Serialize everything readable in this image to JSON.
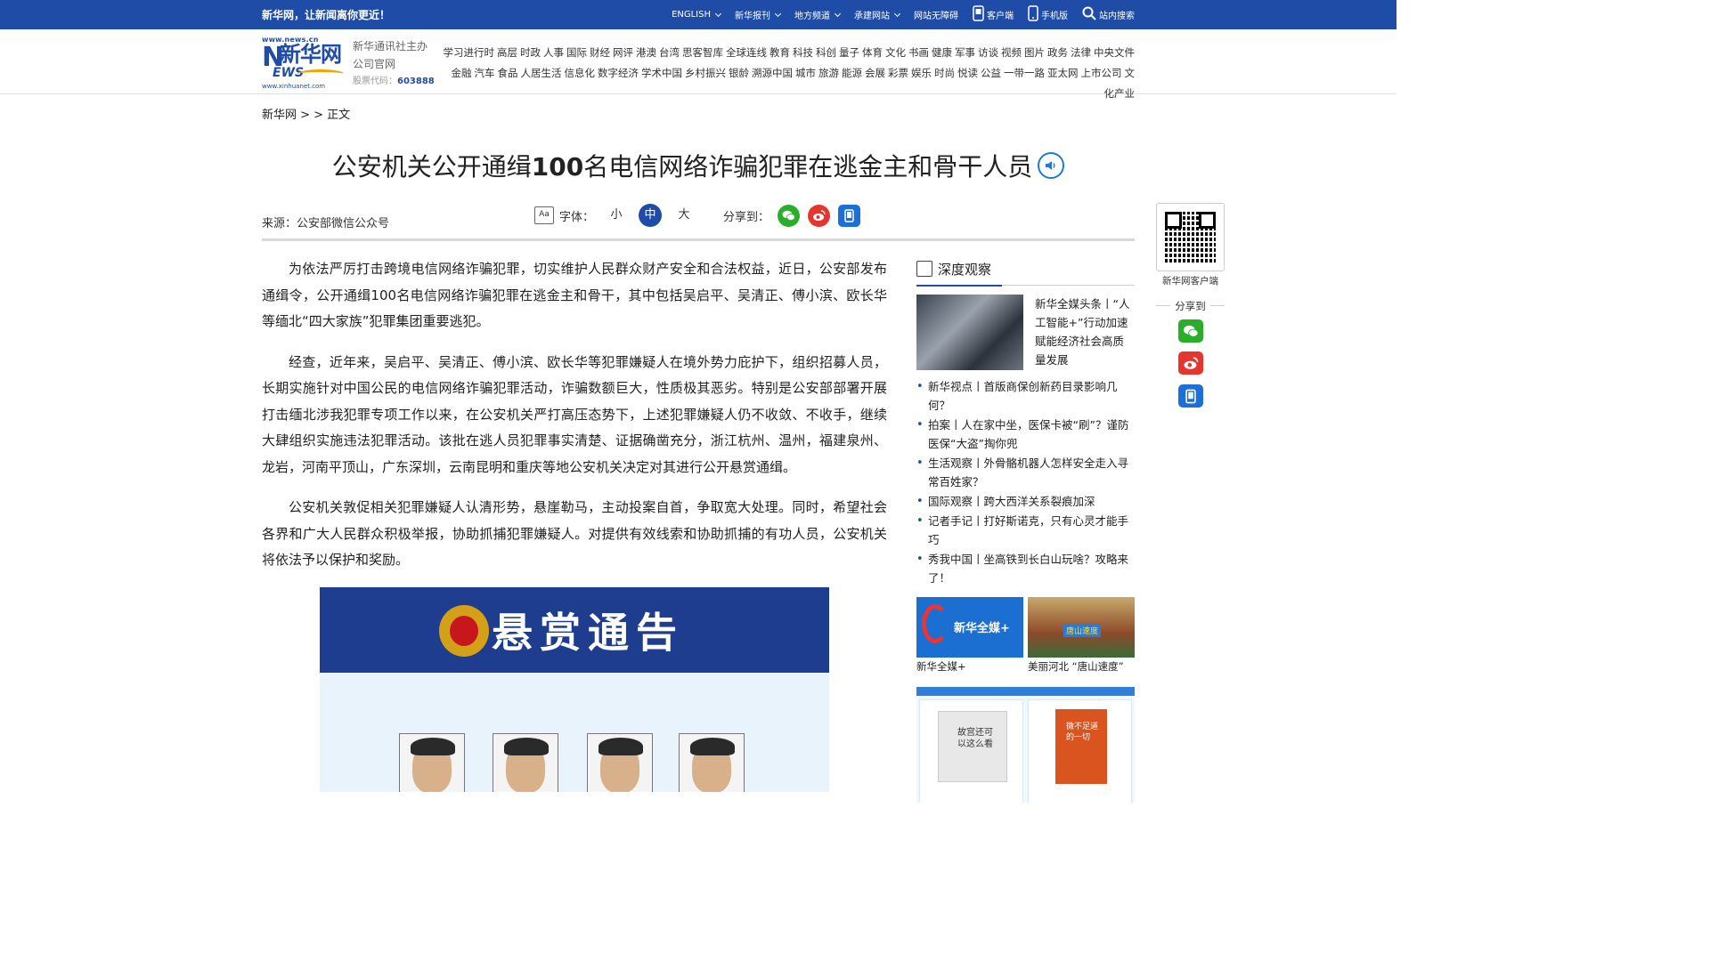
{
  "topbar": {
    "slogan": "新华网，让新闻离你更近！",
    "nav": [
      {
        "label": "ENGLISH",
        "dropdown": true
      },
      {
        "label": "新华报刊",
        "dropdown": true
      },
      {
        "label": "地方频道",
        "dropdown": true
      },
      {
        "label": "承建网站",
        "dropdown": true
      },
      {
        "label": "网站无障碍",
        "dropdown": false
      },
      {
        "label": "客户端",
        "icon": "client-icon"
      },
      {
        "label": "手机版",
        "icon": "phone-icon"
      },
      {
        "label": "站内搜索",
        "icon": "search-icon"
      }
    ],
    "bg_color": "#1e4ca6"
  },
  "header": {
    "logo": {
      "url_top": "www.news.cn",
      "cn": "新华网",
      "n_letter": "N",
      "ews": "EWS",
      "url_bottom": "www.xinhuanet.com"
    },
    "corp_line1": "新华通讯社主办",
    "corp_line2": "公司官网",
    "stock_label": "股票代码：",
    "stock_code": "603888",
    "channels_row1": [
      "学习进行时",
      "高层",
      "时政",
      "人事",
      "国际",
      "财经",
      "网评",
      "港澳",
      "台湾",
      "思客智库",
      "全球连线",
      "教育",
      "科技",
      "科创",
      "量子",
      "体育",
      "文化",
      "书画",
      "健康",
      "军事",
      "访谈",
      "视频",
      "图片",
      "政务",
      "法律",
      "中央文件"
    ],
    "channels_row2": [
      "金融",
      "汽车",
      "食品",
      "人居生活",
      "信息化",
      "数字经济",
      "学术中国",
      "乡村振兴",
      "银龄",
      "溯源中国",
      "城市",
      "旅游",
      "能源",
      "会展",
      "彩票",
      "娱乐",
      "时尚",
      "悦读",
      "公益",
      "一带一路",
      "亚太网",
      "上市公司",
      "文化产业"
    ]
  },
  "breadcrumb": {
    "text": "新华网 > > 正文"
  },
  "article": {
    "title_part1": "公安机关公开通缉",
    "title_bold": "100",
    "title_part2": "名电信网络诈骗犯罪在逃金主和骨干人员",
    "source": "来源：公安部微信公众号",
    "font_label": "字体：",
    "font_small": "小",
    "font_medium": "中",
    "font_large": "大",
    "share_label": "分享到：",
    "paragraphs": [
      "为依法严厉打击跨境电信网络诈骗犯罪，切实维护人民群众财产安全和合法权益，近日，公安部发布通缉令，公开通缉100名电信网络诈骗犯罪在逃金主和骨干，其中包括吴启平、吴清正、傅小滨、欧长华等缅北“四大家族”犯罪集团重要逃犯。",
      "经查，近年来，吴启平、吴清正、傅小滨、欧长华等犯罪嫌疑人在境外势力庇护下，组织招募人员，长期实施针对中国公民的电信网络诈骗犯罪活动，诈骗数额巨大，性质极其恶劣。特别是公安部部署开展打击缅北涉我犯罪专项工作以来，在公安机关严打高压态势下，上述犯罪嫌疑人仍不收敛、不收手，继续大肆组织实施违法犯罪活动。该批在逃人员犯罪事实清楚、证据确凿充分，浙江杭州、温州，福建泉州、龙岩，河南平顶山，广东深圳，云南昆明和重庆等地公安机关决定对其进行公开悬赏通缉。",
      "公安机关敦促相关犯罪嫌疑人认清形势，悬崖勒马，主动投案自首，争取宽大处理。同时，希望社会各界和广大人民群众积极举报，协助抓捕犯罪嫌疑人。对提供有效线索和协助抓捕的有功人员，公安机关将依法予以保护和奖励。"
    ],
    "poster_title": "悬赏通告"
  },
  "sidebar": {
    "title": "深度观察",
    "featured": "新华全媒头条丨“人工智能+”行动加速赋能经济社会高质量发展",
    "news": [
      "新华视点丨首版商保创新药目录影响几何？",
      "拍案丨人在家中坐，医保卡被“刷”？谨防医保“大盗”掏你兜",
      "生活观察丨外骨骼机器人怎样安全走入寻常百姓家？",
      "国际观察丨跨大西洋关系裂痕加深",
      "记者手记丨打好斯诺克，只有心灵才能手巧",
      "秀我中国丨坐高铁到长白山玩啥？攻略来了！"
    ],
    "thumbs": [
      {
        "caption": "新华全媒+",
        "img_text": "新华全媒+"
      },
      {
        "caption": "美丽河北 “唐山速度”",
        "img_text": "唐山速度"
      }
    ],
    "books": [
      {
        "title": "故宫还可以这么看"
      },
      {
        "title": "微不足道的一切"
      }
    ]
  },
  "float_panel": {
    "qr_caption": "新华网客户端",
    "share_label": "分享到"
  },
  "colors": {
    "brand": "#1e4ca6",
    "wechat": "#2aae2a",
    "weibo": "#e6352f",
    "mobile": "#1c6fd6"
  }
}
